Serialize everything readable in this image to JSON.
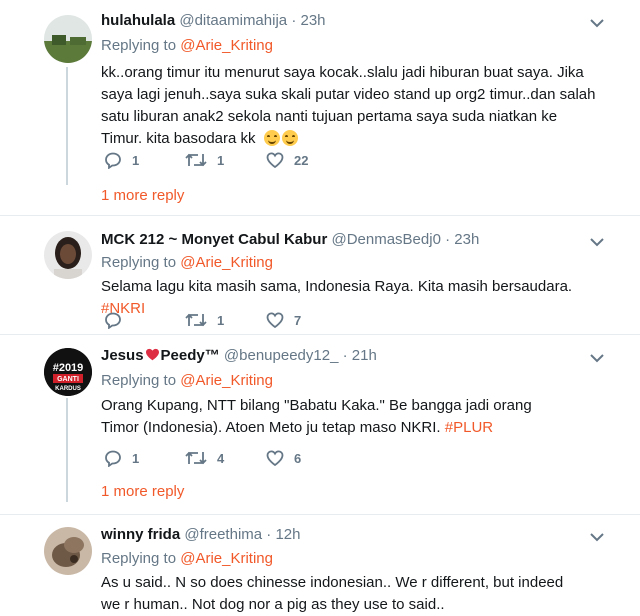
{
  "tweets": [
    {
      "name": "hulahulala",
      "handle": "@ditaamimahija",
      "time": "23h",
      "replying_prefix": "Replying to",
      "replying_to": "@Arie_Kriting",
      "text": "kk..orang timur itu menurut saya kocak..slalu jadi hiburan buat saya. Jika saya lagi jenuh..saya suka skali putar video stand up org2 timur..dan salah satu liburan anak2 sekola nanti tujuan pertama saya suda niatkan ke Timur. kita basodara kk",
      "emoji": [
        "smiling-face-icon",
        "smiling-face-icon"
      ],
      "replies": "1",
      "retweets": "1",
      "likes": "22",
      "more_replies": "1 more reply"
    },
    {
      "name": "MCK 212 ~ Monyet Cabul Kabur",
      "handle": "@DenmasBedj0",
      "time": "23h",
      "replying_prefix": "Replying to",
      "replying_to": "@Arie_Kriting",
      "text": "Selama lagu kita masih sama, Indonesia Raya. Kita masih bersaudara.",
      "hashtag": "#NKRI",
      "replies": "",
      "retweets": "1",
      "likes": "7"
    },
    {
      "name_a": "Jesus",
      "name_b": "Peedy™",
      "handle": "@benupeedy12_",
      "time": "21h",
      "avatar_text_1": "#2019",
      "avatar_text_2": "GANTI",
      "avatar_text_3": "KARDUS",
      "replying_prefix": "Replying to",
      "replying_to": "@Arie_Kriting",
      "text": "Orang Kupang, NTT bilang \"Babatu Kaka.\" Be bangga jadi orang Timor (Indonesia). Atoen Meto ju tetap maso NKRI.",
      "hashtag": "#PLUR",
      "replies": "1",
      "retweets": "4",
      "likes": "6",
      "more_replies": "1 more reply"
    },
    {
      "name": "winny frida",
      "handle": "@freethima",
      "time": "12h",
      "replying_prefix": "Replying to",
      "replying_to": "@Arie_Kriting",
      "text": "As u said.. N so does chinesse indonesian.. We r different, but indeed we r human.. Not dog nor a pig as they use to said.."
    }
  ],
  "colors": {
    "accent": "#f1592a",
    "muted": "#657786",
    "heart": "#e0245e"
  }
}
